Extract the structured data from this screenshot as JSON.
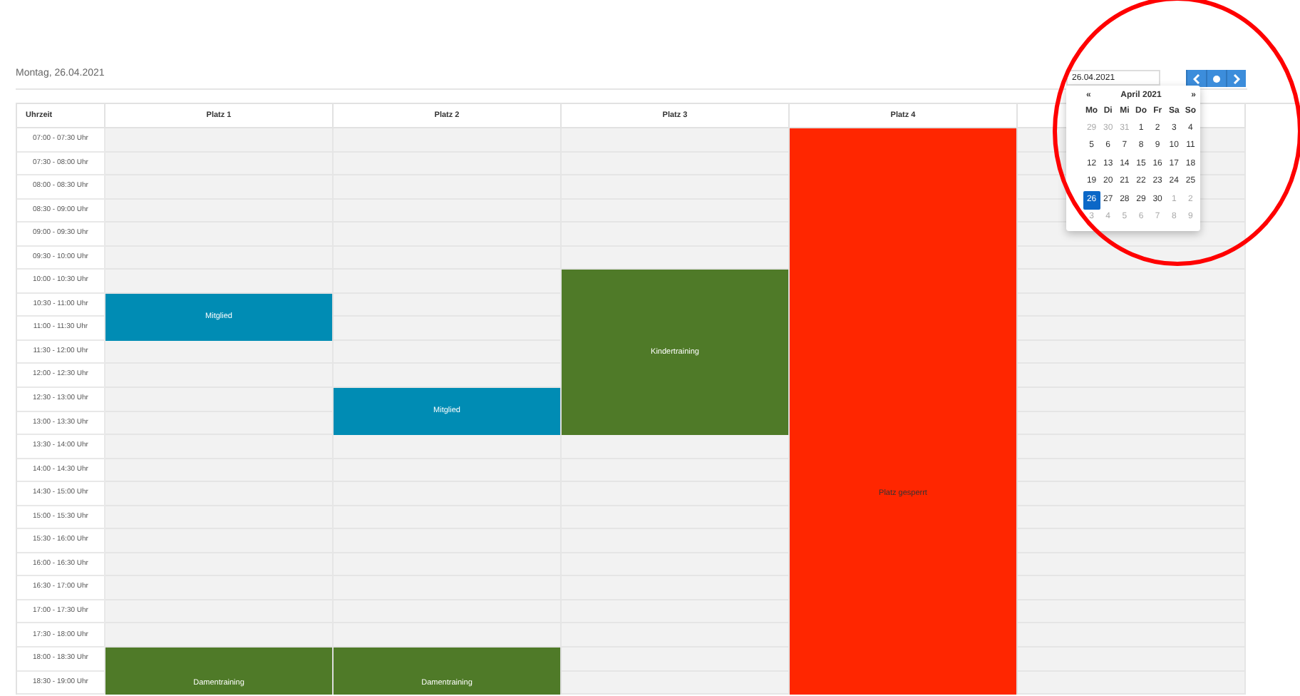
{
  "date_heading": "Montag, 26.04.2021",
  "date_input": {
    "value": "26.04.2021"
  },
  "nav_buttons": [
    {
      "kind": "prev"
    },
    {
      "kind": "today"
    },
    {
      "kind": "next"
    }
  ],
  "table": {
    "time_heading": "Uhrzeit",
    "courts": [
      {
        "name": "Platz 1",
        "bookings": [
          {
            "label": "Mitglied",
            "color": "#008cb4"
          },
          {
            "label": "Damentraining",
            "color": "#4f7a28"
          }
        ]
      },
      {
        "name": "Platz 2",
        "bookings": [
          {
            "label": "Mitglied",
            "color": "#008cb4"
          },
          {
            "label": "Damentraining",
            "color": "#4f7a28"
          }
        ]
      },
      {
        "name": "Platz 3",
        "bookings": [
          {
            "label": "Kindertraining",
            "color": "#4f7a28"
          }
        ]
      },
      {
        "name": "Platz 4",
        "bookings": [
          {
            "label": "Platz gesperrt",
            "color": "#ff2600"
          }
        ]
      }
    ],
    "slots": [
      "07:00 - 07:30 Uhr",
      "07:30 - 08:00 Uhr",
      "08:00 - 08:30 Uhr",
      "08:30 - 09:00 Uhr",
      "09:00 - 09:30 Uhr",
      "09:30 - 10:00 Uhr",
      "10:00 - 10:30 Uhr",
      "10:30 - 11:00 Uhr",
      "11:00 - 11:30 Uhr",
      "11:30 - 12:00 Uhr",
      "12:00 - 12:30 Uhr",
      "12:30 - 13:00 Uhr",
      "13:00 - 13:30 Uhr",
      "13:30 - 14:00 Uhr",
      "14:00 - 14:30 Uhr",
      "14:30 - 15:00 Uhr",
      "15:00 - 15:30 Uhr",
      "15:30 - 16:00 Uhr",
      "16:00 - 16:30 Uhr",
      "16:30 - 17:00 Uhr",
      "17:00 - 17:30 Uhr",
      "17:30 - 18:00 Uhr",
      "18:00 - 18:30 Uhr",
      "18:30 - 19:00 Uhr"
    ]
  },
  "datepicker": {
    "prev": "«",
    "month": "April 2021",
    "next": "»",
    "weekdays": [
      "Mo",
      "Di",
      "Mi",
      "Do",
      "Fr",
      "Sa",
      "So"
    ],
    "days": [
      {
        "label": "29",
        "other_month": true,
        "selected": false
      },
      {
        "label": "30",
        "other_month": true,
        "selected": false
      },
      {
        "label": "31",
        "other_month": true,
        "selected": false
      },
      {
        "label": "1",
        "other_month": false,
        "selected": false
      },
      {
        "label": "2",
        "other_month": false,
        "selected": false
      },
      {
        "label": "3",
        "other_month": false,
        "selected": false
      },
      {
        "label": "4",
        "other_month": false,
        "selected": false
      },
      {
        "label": "5",
        "other_month": false,
        "selected": false
      },
      {
        "label": "6",
        "other_month": false,
        "selected": false
      },
      {
        "label": "7",
        "other_month": false,
        "selected": false
      },
      {
        "label": "8",
        "other_month": false,
        "selected": false
      },
      {
        "label": "9",
        "other_month": false,
        "selected": false
      },
      {
        "label": "10",
        "other_month": false,
        "selected": false
      },
      {
        "label": "11",
        "other_month": false,
        "selected": false
      },
      {
        "label": "12",
        "other_month": false,
        "selected": false
      },
      {
        "label": "13",
        "other_month": false,
        "selected": false
      },
      {
        "label": "14",
        "other_month": false,
        "selected": false
      },
      {
        "label": "15",
        "other_month": false,
        "selected": false
      },
      {
        "label": "16",
        "other_month": false,
        "selected": false
      },
      {
        "label": "17",
        "other_month": false,
        "selected": false
      },
      {
        "label": "18",
        "other_month": false,
        "selected": false
      },
      {
        "label": "19",
        "other_month": false,
        "selected": false
      },
      {
        "label": "20",
        "other_month": false,
        "selected": false
      },
      {
        "label": "21",
        "other_month": false,
        "selected": false
      },
      {
        "label": "22",
        "other_month": false,
        "selected": false
      },
      {
        "label": "23",
        "other_month": false,
        "selected": false
      },
      {
        "label": "24",
        "other_month": false,
        "selected": false
      },
      {
        "label": "25",
        "other_month": false,
        "selected": false
      },
      {
        "label": "26",
        "other_month": false,
        "selected": true
      },
      {
        "label": "27",
        "other_month": false,
        "selected": false
      },
      {
        "label": "28",
        "other_month": false,
        "selected": false
      },
      {
        "label": "29",
        "other_month": false,
        "selected": false
      },
      {
        "label": "30",
        "other_month": false,
        "selected": false
      },
      {
        "label": "1",
        "other_month": true,
        "selected": false
      },
      {
        "label": "2",
        "other_month": true,
        "selected": false
      },
      {
        "label": "3",
        "other_month": true,
        "selected": false
      },
      {
        "label": "4",
        "other_month": true,
        "selected": false
      },
      {
        "label": "5",
        "other_month": true,
        "selected": false
      },
      {
        "label": "6",
        "other_month": true,
        "selected": false
      },
      {
        "label": "7",
        "other_month": true,
        "selected": false
      },
      {
        "label": "8",
        "other_month": true,
        "selected": false
      },
      {
        "label": "9",
        "other_month": true,
        "selected": false
      }
    ]
  },
  "annotation": {
    "kind": "circle",
    "color": "#ff0000"
  }
}
